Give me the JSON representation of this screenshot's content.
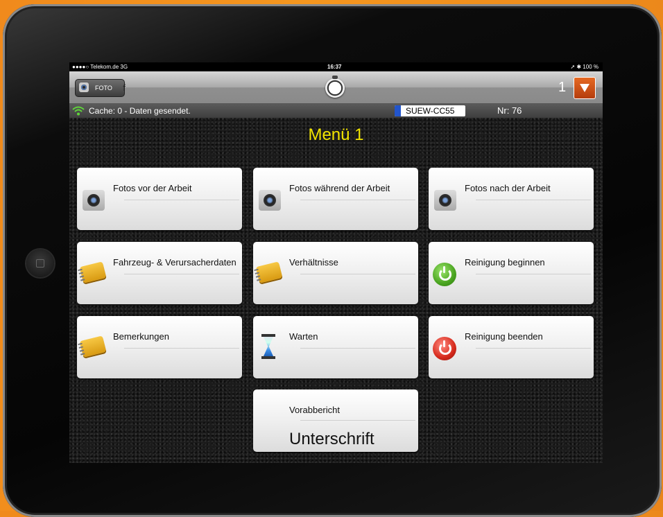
{
  "status_bar": {
    "carrier": "●●●●○ Telekom.de  3G",
    "time": "16:37",
    "battery": "➚ ✱ 100 %"
  },
  "top_bar": {
    "foto_label": "FOTO",
    "foto_trail": "f",
    "counter": "1"
  },
  "info_bar": {
    "cache_text": "Cache: 0  -  Daten gesendet.",
    "plate": "SUEW-CC55",
    "nr": "Nr: 76"
  },
  "menu": {
    "title": "Menü 1",
    "tiles": [
      {
        "label": "Fotos vor der Arbeit",
        "icon": "camera-icon"
      },
      {
        "label": "Fotos während der Arbeit",
        "icon": "camera-icon"
      },
      {
        "label": "Fotos nach der Arbeit",
        "icon": "camera-icon"
      },
      {
        "label": "Fahrzeug- & Verursacherdaten",
        "icon": "notebook-icon"
      },
      {
        "label": "Verhältnisse",
        "icon": "notebook-icon"
      },
      {
        "label": "Reinigung beginnen",
        "icon": "power-green-icon"
      },
      {
        "label": "Bemerkungen",
        "icon": "notebook-icon"
      },
      {
        "label": "Warten",
        "icon": "hourglass-icon"
      },
      {
        "label": "Reinigung beenden",
        "icon": "power-red-icon"
      },
      {
        "label": "Vorabbericht",
        "sublabel": "Unterschrift",
        "icon": ""
      }
    ]
  },
  "colors": {
    "title": "#f2e400",
    "accent_orange": "#f08a1c"
  }
}
